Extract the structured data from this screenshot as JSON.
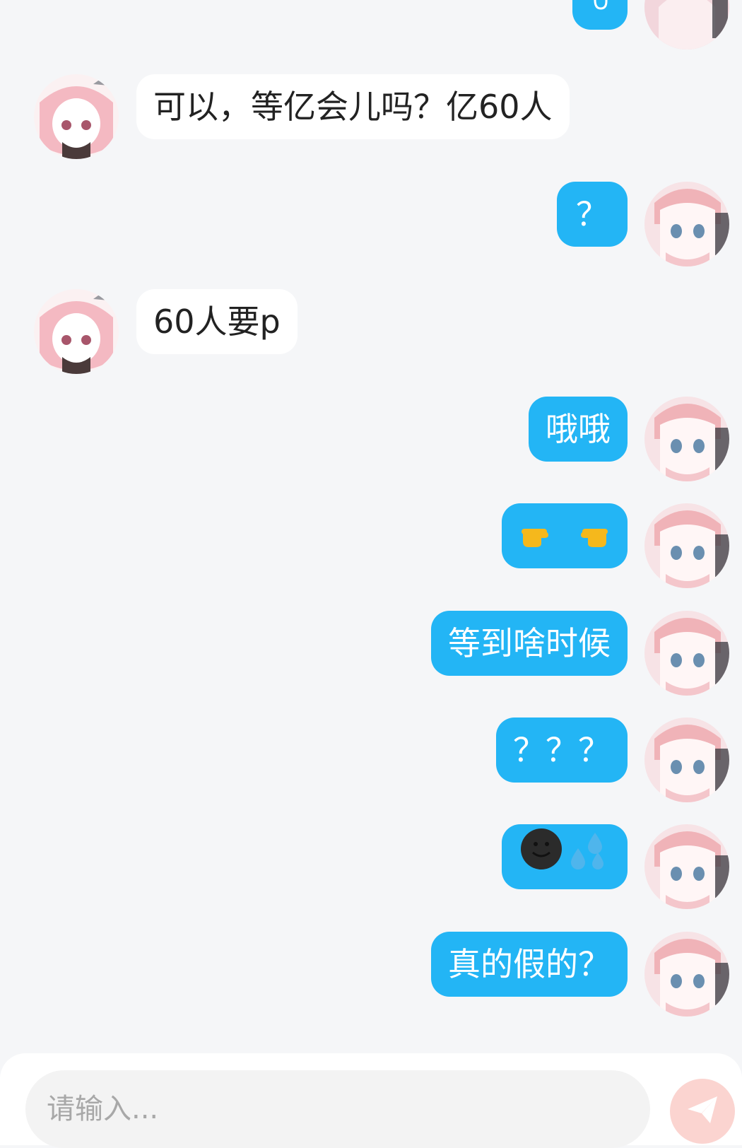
{
  "messages": [
    {
      "side": "out",
      "text": "",
      "icon": "hand-emoji"
    },
    {
      "side": "in",
      "text": "可以，等亿会儿吗？亿60人"
    },
    {
      "side": "out",
      "text": "？"
    },
    {
      "side": "in",
      "text": "60人要p"
    },
    {
      "side": "out",
      "text": "哦哦"
    },
    {
      "side": "out",
      "text": "",
      "icon": "pointing-hands-emoji"
    },
    {
      "side": "out",
      "text": "等到啥时候"
    },
    {
      "side": "out",
      "text": "？？？"
    },
    {
      "side": "out",
      "text": "",
      "icon": "dark-smile-sweat-emoji"
    },
    {
      "side": "out",
      "text": "真的假的？"
    }
  ],
  "composer": {
    "placeholder": "请输入...",
    "send_icon": "send-icon"
  },
  "colors": {
    "background": "#f5f6f8",
    "outgoing_bubble": "#23b5f5",
    "incoming_bubble": "#ffffff",
    "send_button": "#fbd4d0"
  }
}
